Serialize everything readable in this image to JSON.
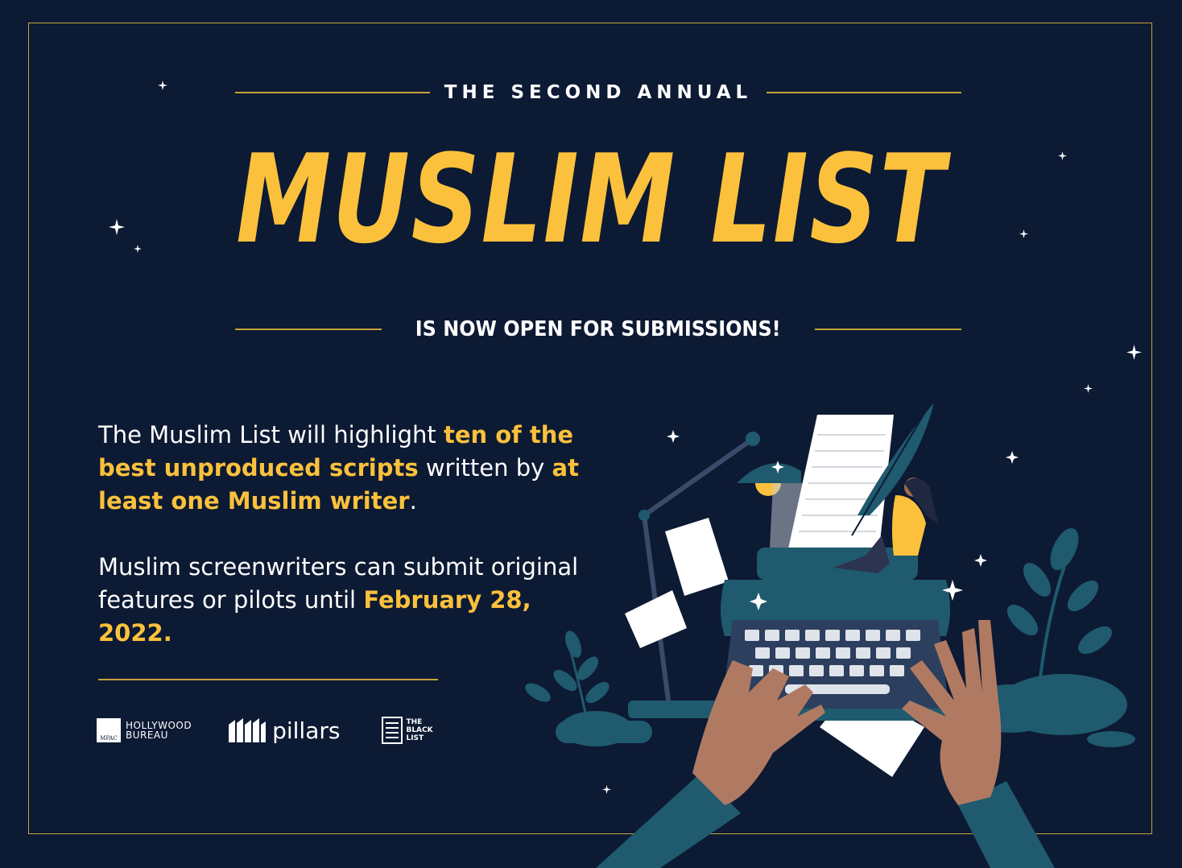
{
  "header": {
    "kicker": "THE SECOND ANNUAL",
    "title": "MUSLIM LIST",
    "subtitle": "IS NOW OPEN FOR SUBMISSIONS!"
  },
  "body": {
    "p1_a": "The Muslim List will highlight ",
    "p1_hl1": "ten of the best unproduced scripts",
    "p1_b": " written by ",
    "p1_hl2": "at least one Muslim writer",
    "p1_c": ".",
    "p2_a": "Muslim screenwriters can submit original features or pilots until ",
    "p2_hl": "February 28, 2022."
  },
  "logos": {
    "mpac_small": "MPAC",
    "hollywood_line1": "HOLLYWOOD",
    "hollywood_line2": "BUREAU",
    "pillars": "pillars",
    "blacklist_line1": "THE",
    "blacklist_line2": "BLACK",
    "blacklist_line3": "LIST"
  },
  "colors": {
    "background": "#0d1a33",
    "accent": "#fbc13c",
    "rule": "#c9a13a",
    "illustration_teal": "#1f5a6e"
  },
  "icons": [
    "sparkle-star-icon",
    "crescent-moon-icon",
    "typewriter-illustration",
    "quill-icon",
    "desk-lamp-icon"
  ]
}
